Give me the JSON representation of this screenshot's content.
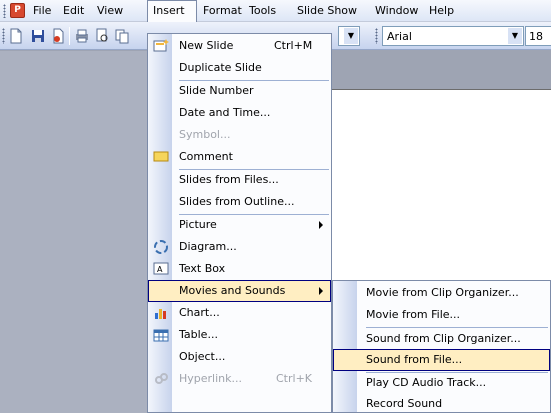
{
  "menubar": {
    "items": [
      "File",
      "Edit",
      "View",
      "Insert",
      "Format",
      "Tools",
      "Slide Show",
      "Window",
      "Help"
    ]
  },
  "toolbar": {
    "font_name": "Arial",
    "font_size": "18"
  },
  "insert_menu": {
    "items": [
      {
        "label": "New Slide",
        "shortcut": "Ctrl+M",
        "icon": "new-slide-icon"
      },
      {
        "label": "Duplicate Slide"
      },
      {
        "label": "Slide Number"
      },
      {
        "label": "Date and Time..."
      },
      {
        "label": "Symbol...",
        "disabled": true
      },
      {
        "label": "Comment",
        "icon": "comment-icon"
      },
      {
        "label": "Slides from Files..."
      },
      {
        "label": "Slides from Outline..."
      },
      {
        "label": "Picture",
        "submenu": true
      },
      {
        "label": "Diagram...",
        "icon": "diagram-icon"
      },
      {
        "label": "Text Box",
        "icon": "text-box-icon"
      },
      {
        "label": "Movies and Sounds",
        "submenu": true,
        "highlighted": true
      },
      {
        "label": "Chart...",
        "icon": "chart-icon"
      },
      {
        "label": "Table...",
        "icon": "table-icon"
      },
      {
        "label": "Object..."
      },
      {
        "label": "Hyperlink...",
        "shortcut": "Ctrl+K",
        "disabled": true,
        "icon": "hyperlink-icon"
      }
    ]
  },
  "movies_sounds_submenu": {
    "items": [
      {
        "label": "Movie from Clip Organizer..."
      },
      {
        "label": "Movie from File..."
      },
      {
        "label": "Sound from Clip Organizer..."
      },
      {
        "label": "Sound from File...",
        "highlighted": true
      },
      {
        "label": "Play CD Audio Track..."
      },
      {
        "label": "Record Sound"
      }
    ]
  },
  "colors": {
    "menu_highlight": "#ffeec2",
    "highlight_border": "#000080",
    "menu_gutter": "#c7d3ec",
    "workspace": "#9ea4b3"
  }
}
